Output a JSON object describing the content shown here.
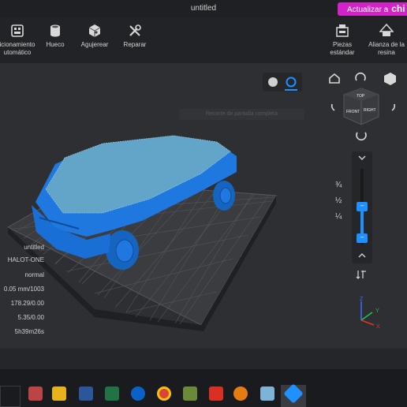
{
  "window": {
    "title": "untitled"
  },
  "upgrade": {
    "label": "Actualizar a",
    "brand": "chi"
  },
  "toolbar": {
    "auto_layout": "icionamiento\nutomático",
    "hollow": "Hueco",
    "drill": "Agujerear",
    "repair": "Reparar",
    "std_parts": "Piezas\nestándar",
    "alliance": "Alianza de la\nresina"
  },
  "viewport": {
    "tooltip": "Recorte de pantalla completa"
  },
  "cube": {
    "top": "TOP",
    "front": "FRONT",
    "right": "RIGHT"
  },
  "info": {
    "name": "untitled",
    "printer": "HALOT-ONE",
    "mode": "normal",
    "layer": "0.05 mm/1003",
    "volume": "178.29/0.00",
    "weight": "5.35/0.00",
    "time": "5h39m26s"
  },
  "slider": {
    "q3": "¾",
    "half": "½",
    "q1": "¼",
    "upper_handle": "–",
    "lower_handle": "–"
  },
  "axes": {
    "x": "X",
    "y": "Y",
    "z": "Z"
  },
  "colors": {
    "accent": "#1e90ff",
    "model": "#1a73e8",
    "upgrade": "#d322c8"
  }
}
